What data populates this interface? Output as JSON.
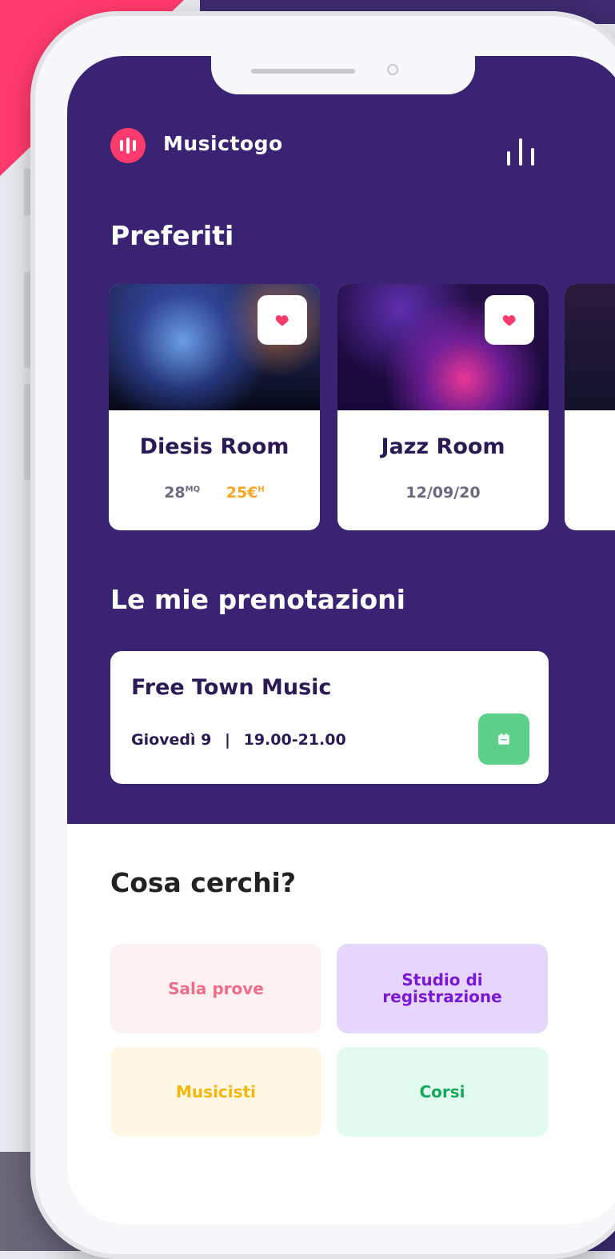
{
  "app": {
    "name": "Musictogo"
  },
  "favorites": {
    "title": "Preferiti",
    "items": [
      {
        "name": "Diesis Room",
        "size": "28",
        "size_unit": "MQ",
        "price": "25€",
        "price_unit": "H"
      },
      {
        "name": "Jazz Room",
        "date": "12/09/20"
      }
    ]
  },
  "bookings": {
    "title": "Le mie prenotazioni",
    "items": [
      {
        "name": "Free Town Music",
        "day": "Giovedì 9",
        "separator": "|",
        "time": "19.00-21.00"
      }
    ]
  },
  "search": {
    "title": "Cosa cerchi?",
    "categories": [
      {
        "label": "Sala prove",
        "bg": "#fdf1f2",
        "color": "#f26b8a"
      },
      {
        "label": "Studio di registrazione",
        "bg": "#e6d6fb",
        "color": "#7a18d6"
      },
      {
        "label": "Musicisti",
        "bg": "#fff6e3",
        "color": "#f5b707"
      },
      {
        "label": "Corsi",
        "bg": "#e2fbef",
        "color": "#16a85a"
      }
    ]
  },
  "colors": {
    "brand": "#ff3a6d",
    "header_bg": "#3b2373",
    "heart": "#ff3a6d",
    "calendar_button": "#5cd08a"
  },
  "icons": [
    "logo-icon",
    "menu-bars-icon",
    "heart-icon",
    "calendar-icon"
  ]
}
